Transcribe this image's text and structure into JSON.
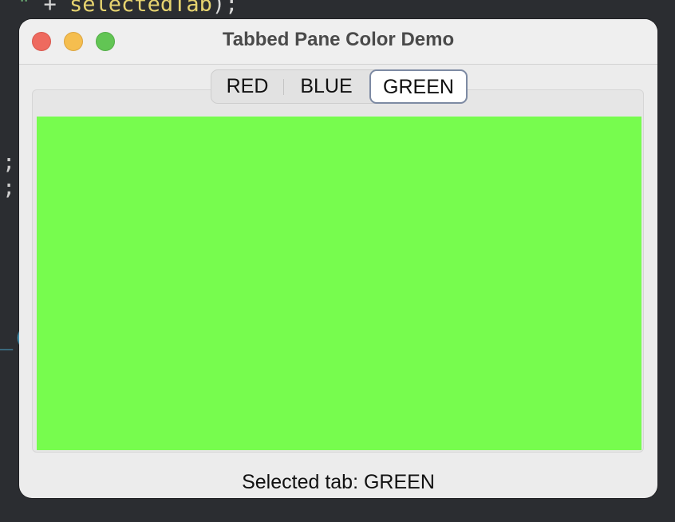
{
  "editor": {
    "code_line_top_str": "\" ",
    "code_line_top_op": "+ ",
    "code_line_top_ident": "selectedTab",
    "code_line_top_end": ");",
    "semicolon_1": ";",
    "semicolon_2": ";",
    "fragment": "_("
  },
  "window": {
    "title": "Tabbed Pane Color Demo"
  },
  "tabs": [
    {
      "label": "RED",
      "selected": false
    },
    {
      "label": "BLUE",
      "selected": false
    },
    {
      "label": "GREEN",
      "selected": true
    }
  ],
  "content": {
    "panel_color": "#77fc4e"
  },
  "status": {
    "text": "Selected tab: GREEN"
  }
}
